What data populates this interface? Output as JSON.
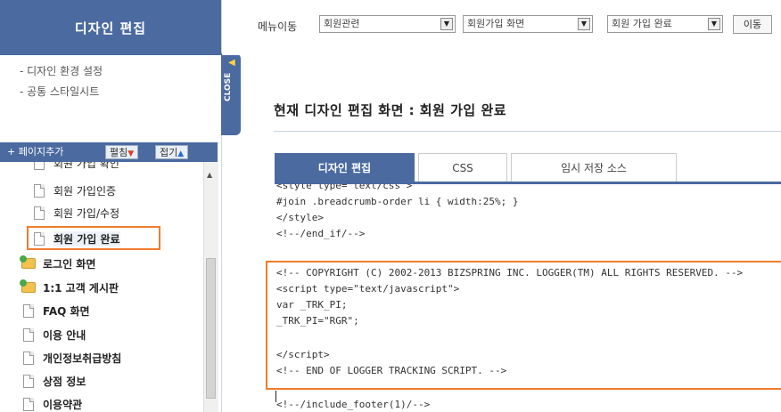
{
  "sidebar": {
    "title": "디자인 편집",
    "links": [
      "- 디자인 환경 설정",
      "- 공통 스타일시트"
    ],
    "toolbar": {
      "add_page": "+ 페이지추가",
      "expand": "펼침",
      "collapse": "접기"
    },
    "close_tab_label": "CLOSE",
    "tree": [
      {
        "label": "회원 가입 확인",
        "icon": "page-icon",
        "bold": false
      },
      {
        "label": "회원 가입인증",
        "icon": "page-icon",
        "bold": false
      },
      {
        "label": "회원 가입/수정",
        "icon": "page-icon",
        "bold": false
      },
      {
        "label": "회원 가입 완료",
        "icon": "page-icon",
        "bold": false,
        "selected": true
      },
      {
        "label": "로그인 화면",
        "icon": "folder-icon",
        "bold": true
      },
      {
        "label": "1:1 고객 게시판",
        "icon": "folder-icon",
        "bold": true
      },
      {
        "label": "FAQ 화면",
        "icon": "page-icon",
        "bold": true
      },
      {
        "label": "이용 안내",
        "icon": "page-icon",
        "bold": true
      },
      {
        "label": "개인정보취급방침",
        "icon": "page-icon",
        "bold": true
      },
      {
        "label": "상점 정보",
        "icon": "page-icon",
        "bold": true
      },
      {
        "label": "이용약관",
        "icon": "page-icon",
        "bold": true
      }
    ]
  },
  "topbar": {
    "menu_label": "메뉴이동",
    "select1": "회원관련",
    "select2": "회원가입 화면",
    "select3": "회원 가입 완료",
    "move_button": "이동"
  },
  "main": {
    "title": "현재 디자인 편집 화면 : 회원 가입 완료",
    "tabs": [
      "디자인 편집",
      "CSS",
      "임시 저장 소스"
    ],
    "active_tab": 0,
    "code_lines": [
      "<style type=\"text/css\">",
      "#join .breadcrumb-order li { width:25%; }",
      "</style>",
      "<!--/end_if/-->",
      "",
      "",
      "<!-- COPYRIGHT (C) 2002-2013 BIZSPRING INC. LOGGER(TM) ALL RIGHTS RESERVED. -->",
      "<script type=\"text/javascript\">",
      "var _TRK_PI;",
      "_TRK_PI=\"RGR\";",
      "",
      "</script>",
      "<!-- END OF LOGGER TRACKING SCRIPT. -->",
      "",
      "",
      "<!--/include_footer(1)/-->"
    ]
  },
  "colors": {
    "accent": "#4a6aa0",
    "highlight": "#f07c2b"
  }
}
